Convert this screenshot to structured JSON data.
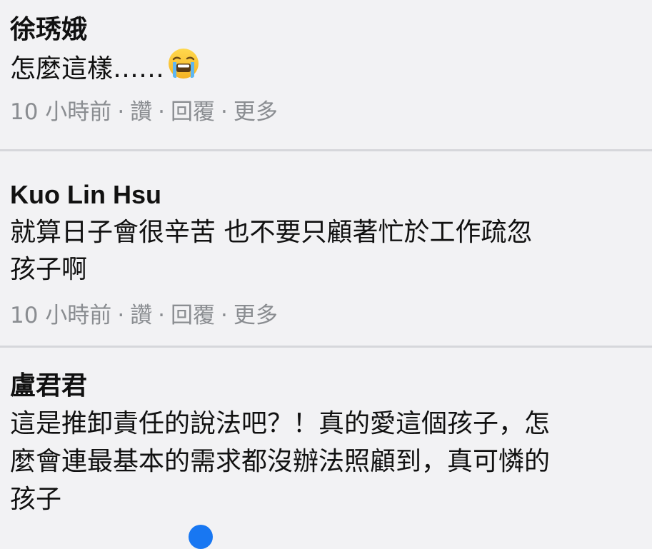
{
  "comments": [
    {
      "author": "徐琇娥",
      "text": "怎麼這樣……",
      "emoji": "loudly-crying-face",
      "time": "10 小時前",
      "sep": "·",
      "like": "讚",
      "reply": "回覆",
      "more": "更多"
    },
    {
      "author": "Kuo Lin Hsu",
      "text_line1": "就算日子會很辛苦 也不要只顧著忙於工作疏忽",
      "text_line2": "孩子啊",
      "time": "10 小時前",
      "sep": "·",
      "like": "讚",
      "reply": "回覆",
      "more": "更多"
    },
    {
      "author": "盧君君",
      "text_line1": "這是推卸責任的說法吧？！真的愛這個孩子，怎",
      "text_line2": "麼會連最基本的需求都沒辦法照顧到，真可憐的",
      "text_line3": "孩子"
    }
  ],
  "colors": {
    "background": "#f2f2f4",
    "meta_text": "#8a8d91",
    "divider": "#d6d7db",
    "reaction_blue": "#1877f2"
  }
}
